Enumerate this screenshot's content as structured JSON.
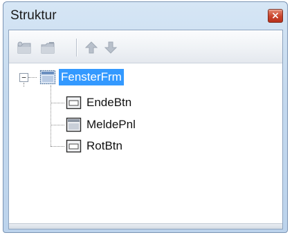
{
  "window": {
    "title": "Struktur",
    "close_label": "×"
  },
  "toolbar": {
    "items": [
      {
        "icon": "folder-add-icon",
        "enabled": false
      },
      {
        "icon": "folder-remove-icon",
        "enabled": false
      },
      {
        "icon": "arrow-up-icon",
        "enabled": false
      },
      {
        "icon": "arrow-down-icon",
        "enabled": false
      }
    ]
  },
  "tree": {
    "root": {
      "label": "FensterFrm",
      "expanded": true,
      "selected": true,
      "expander_symbol": "−",
      "icon": "form-icon",
      "children": [
        {
          "label": "EndeBtn",
          "icon": "button-control-icon"
        },
        {
          "label": "MeldePnl",
          "icon": "panel-control-icon"
        },
        {
          "label": "RotBtn",
          "icon": "button-control-icon"
        }
      ]
    }
  },
  "colors": {
    "selection": "#3399ff",
    "close_button": "#c9432b",
    "frame": "#c4d9ee"
  }
}
